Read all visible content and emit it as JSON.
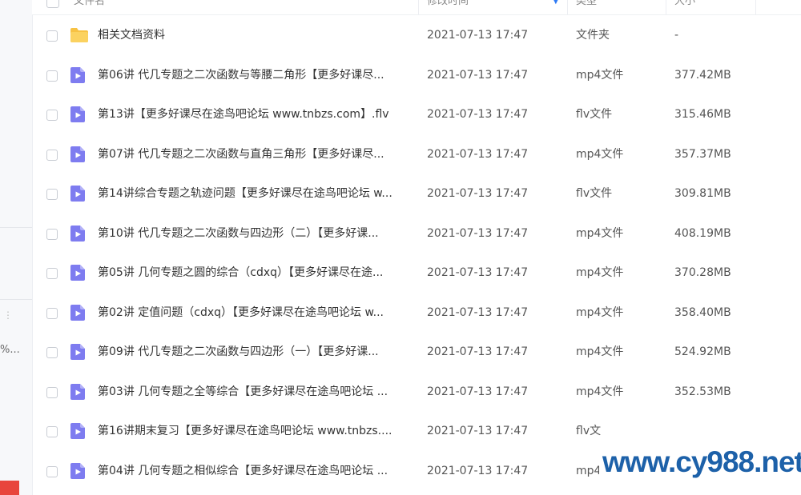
{
  "header": {
    "name": "文件名",
    "modified": "修改时间",
    "type": "类型",
    "size": "大小"
  },
  "colors": {
    "folder": "#f7c244",
    "video": "#7e7cf0",
    "sort_accent": "#2f7bf5",
    "watermark": "#1d61a9"
  },
  "rows": [
    {
      "icon": "folder-icon",
      "name": "相关文档资料",
      "time": "2021-07-13 17:47",
      "type": "文件夹",
      "size": "-"
    },
    {
      "icon": "video-file-icon",
      "name": "第06讲 代几专题之二次函数与等腰二角形【更多好课尽...",
      "time": "2021-07-13 17:47",
      "type": "mp4文件",
      "size": "377.42MB"
    },
    {
      "icon": "video-file-icon",
      "name": "第13讲【更多好课尽在途鸟吧论坛 www.tnbzs.com】.flv",
      "time": "2021-07-13 17:47",
      "type": "flv文件",
      "size": "315.46MB"
    },
    {
      "icon": "video-file-icon",
      "name": "第07讲 代几专题之二次函数与直角三角形【更多好课尽...",
      "time": "2021-07-13 17:47",
      "type": "mp4文件",
      "size": "357.37MB"
    },
    {
      "icon": "video-file-icon",
      "name": "第14讲综合专题之轨迹问题【更多好课尽在途鸟吧论坛 w...",
      "time": "2021-07-13 17:47",
      "type": "flv文件",
      "size": "309.81MB"
    },
    {
      "icon": "video-file-icon",
      "name": "第10讲 代几专题之二次函数与四边形（二）【更多好课...",
      "time": "2021-07-13 17:47",
      "type": "mp4文件",
      "size": "408.19MB"
    },
    {
      "icon": "video-file-icon",
      "name": "第05讲 几何专题之圆的综合（cdxq）【更多好课尽在途...",
      "time": "2021-07-13 17:47",
      "type": "mp4文件",
      "size": "370.28MB"
    },
    {
      "icon": "video-file-icon",
      "name": "第02讲 定值问题（cdxq）【更多好课尽在途鸟吧论坛 w...",
      "time": "2021-07-13 17:47",
      "type": "mp4文件",
      "size": "358.40MB"
    },
    {
      "icon": "video-file-icon",
      "name": "第09讲 代几专题之二次函数与四边形（一）【更多好课...",
      "time": "2021-07-13 17:47",
      "type": "mp4文件",
      "size": "524.92MB"
    },
    {
      "icon": "video-file-icon",
      "name": "第03讲 几何专题之全等综合【更多好课尽在途鸟吧论坛 ...",
      "time": "2021-07-13 17:47",
      "type": "mp4文件",
      "size": "352.53MB"
    },
    {
      "icon": "video-file-icon",
      "name": "第16讲期末复习【更多好课尽在途鸟吧论坛 www.tnbzs....",
      "time": "2021-07-13 17:47",
      "type": "flv文",
      "size": ""
    },
    {
      "icon": "video-file-icon",
      "name": "第04讲 几何专题之相似综合【更多好课尽在途鸟吧论坛 ...",
      "time": "2021-07-13 17:47",
      "type": "mp4",
      "size": ""
    }
  ],
  "sidebar": {
    "dots": "⋮",
    "truncated": "%..."
  },
  "watermark": "www.cy988.net"
}
